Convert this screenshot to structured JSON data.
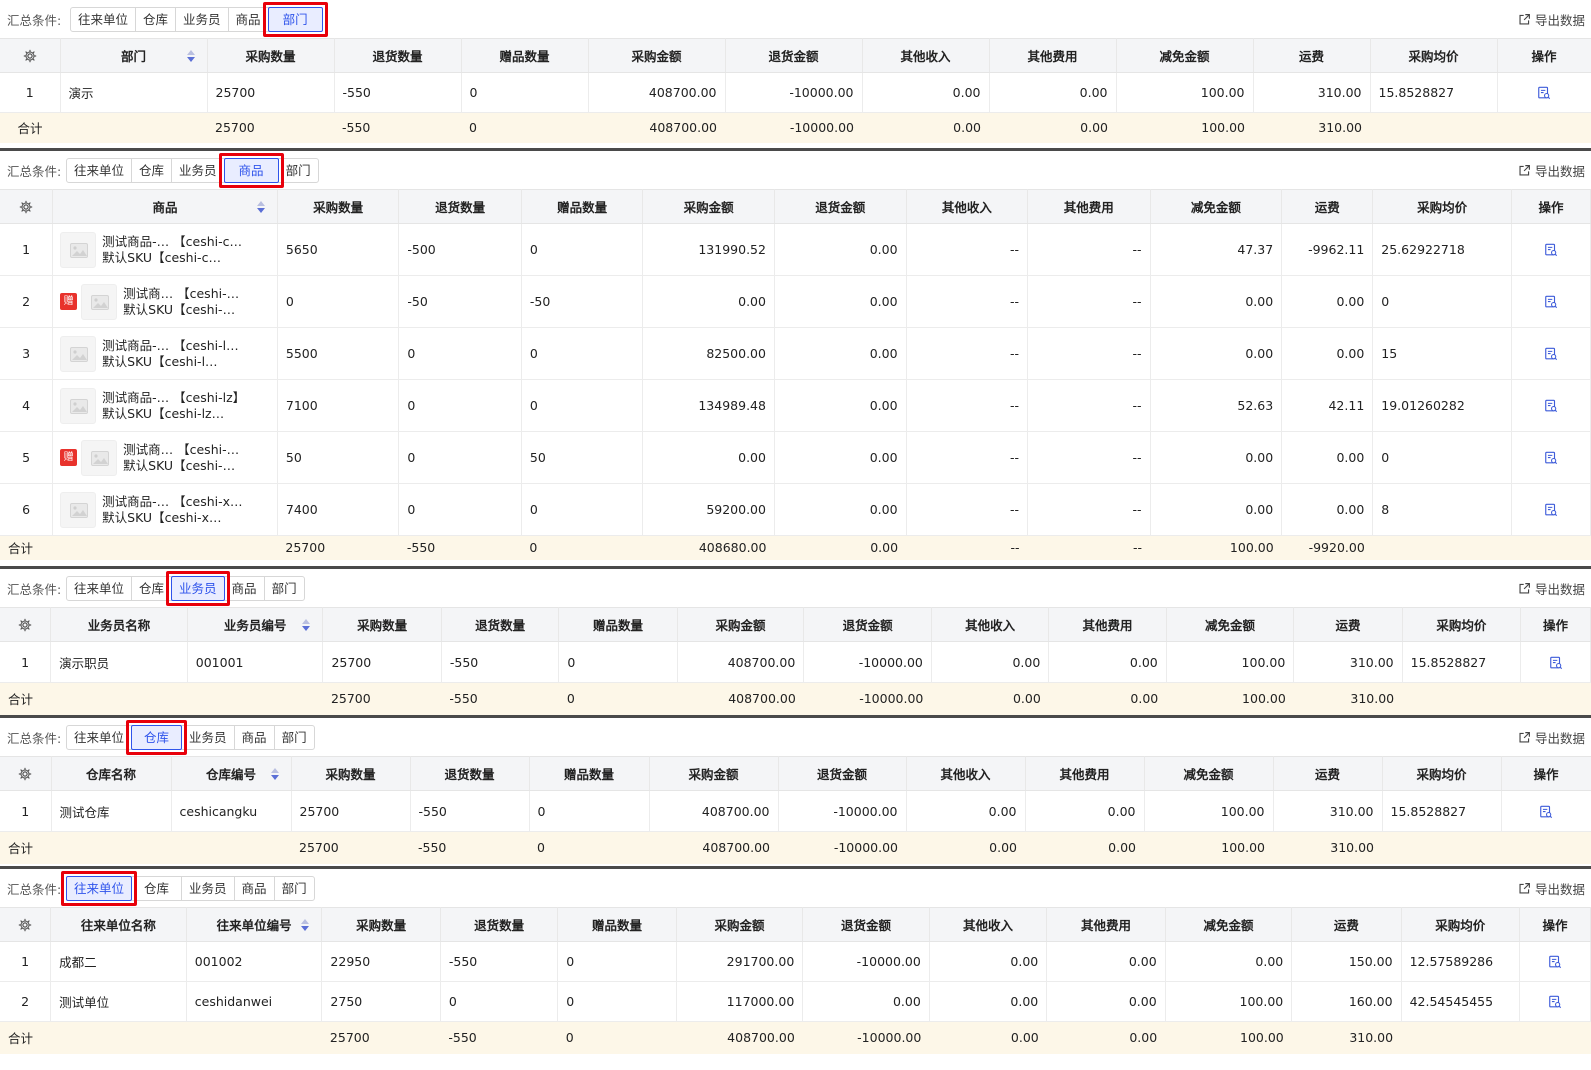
{
  "filter_label": "汇总条件:",
  "tabs": [
    "往来单位",
    "仓库",
    "业务员",
    "商品",
    "部门"
  ],
  "export_label": "导出数据",
  "total_label": "合计",
  "panels": {
    "dept": {
      "active_tab": "部门",
      "headers": [
        "部门",
        "采购数量",
        "退货数量",
        "赠品数量",
        "采购金额",
        "退货金额",
        "其他收入",
        "其他费用",
        "减免金额",
        "运费",
        "采购均价",
        "操作"
      ],
      "rows": [
        {
          "idx": "1",
          "name": "演示",
          "qty": "25700",
          "ret": "-550",
          "gift": "0",
          "amount": "408700.00",
          "ret_amount": "-10000.00",
          "other_in": "0.00",
          "other_fee": "0.00",
          "discount": "100.00",
          "freight": "310.00",
          "avg": "15.8528827"
        }
      ],
      "total": {
        "qty": "25700",
        "ret": "-550",
        "gift": "0",
        "amount": "408700.00",
        "ret_amount": "-10000.00",
        "other_in": "0.00",
        "other_fee": "0.00",
        "discount": "100.00",
        "freight": "310.00"
      }
    },
    "goods": {
      "active_tab": "商品",
      "headers": [
        "商品",
        "采购数量",
        "退货数量",
        "赠品数量",
        "采购金额",
        "退货金额",
        "其他收入",
        "其他费用",
        "减免金额",
        "运费",
        "采购均价",
        "操作"
      ],
      "gift_badge": "赠",
      "rows": [
        {
          "idx": "1",
          "line1": "测试商品-… 【ceshi-c…",
          "line2": "默认SKU【ceshi-c…",
          "gift_flag": false,
          "qty": "5650",
          "ret": "-500",
          "gift": "0",
          "amount": "131990.52",
          "ret_amount": "0.00",
          "other_in": "--",
          "other_fee": "--",
          "discount": "47.37",
          "freight": "-9962.11",
          "avg": "25.62922718"
        },
        {
          "idx": "2",
          "line1": "测试商… 【ceshi-…",
          "line2": "默认SKU【ceshi-…",
          "gift_flag": true,
          "qty": "0",
          "ret": "-50",
          "gift": "-50",
          "amount": "0.00",
          "ret_amount": "0.00",
          "other_in": "--",
          "other_fee": "--",
          "discount": "0.00",
          "freight": "0.00",
          "avg": "0"
        },
        {
          "idx": "3",
          "line1": "测试商品-… 【ceshi-l…",
          "line2": "默认SKU【ceshi-l…",
          "gift_flag": false,
          "qty": "5500",
          "ret": "0",
          "gift": "0",
          "amount": "82500.00",
          "ret_amount": "0.00",
          "other_in": "--",
          "other_fee": "--",
          "discount": "0.00",
          "freight": "0.00",
          "avg": "15"
        },
        {
          "idx": "4",
          "line1": "测试商品-… 【ceshi-lz】",
          "line2": "默认SKU【ceshi-lz…",
          "gift_flag": false,
          "qty": "7100",
          "ret": "0",
          "gift": "0",
          "amount": "134989.48",
          "ret_amount": "0.00",
          "other_in": "--",
          "other_fee": "--",
          "discount": "52.63",
          "freight": "42.11",
          "avg": "19.01260282"
        },
        {
          "idx": "5",
          "line1": "测试商… 【ceshi-…",
          "line2": "默认SKU【ceshi-…",
          "gift_flag": true,
          "qty": "50",
          "ret": "0",
          "gift": "50",
          "amount": "0.00",
          "ret_amount": "0.00",
          "other_in": "--",
          "other_fee": "--",
          "discount": "0.00",
          "freight": "0.00",
          "avg": "0"
        },
        {
          "idx": "6",
          "line1": "测试商品-… 【ceshi-x…",
          "line2": "默认SKU【ceshi-x…",
          "gift_flag": false,
          "qty": "7400",
          "ret": "0",
          "gift": "0",
          "amount": "59200.00",
          "ret_amount": "0.00",
          "other_in": "--",
          "other_fee": "--",
          "discount": "0.00",
          "freight": "0.00",
          "avg": "8"
        }
      ],
      "total": {
        "qty": "25700",
        "ret": "-550",
        "gift": "0",
        "amount": "408680.00",
        "ret_amount": "0.00",
        "other_in": "--",
        "other_fee": "--",
        "discount": "100.00",
        "freight": "-9920.00"
      }
    },
    "staff": {
      "active_tab": "业务员",
      "headers": [
        "业务员名称",
        "业务员编号",
        "采购数量",
        "退货数量",
        "赠品数量",
        "采购金额",
        "退货金额",
        "其他收入",
        "其他费用",
        "减免金额",
        "运费",
        "采购均价",
        "操作"
      ],
      "rows": [
        {
          "idx": "1",
          "name": "演示职员",
          "code": "001001",
          "qty": "25700",
          "ret": "-550",
          "gift": "0",
          "amount": "408700.00",
          "ret_amount": "-10000.00",
          "other_in": "0.00",
          "other_fee": "0.00",
          "discount": "100.00",
          "freight": "310.00",
          "avg": "15.8528827"
        }
      ],
      "total": {
        "qty": "25700",
        "ret": "-550",
        "gift": "0",
        "amount": "408700.00",
        "ret_amount": "-10000.00",
        "other_in": "0.00",
        "other_fee": "0.00",
        "discount": "100.00",
        "freight": "310.00"
      }
    },
    "warehouse": {
      "active_tab": "仓库",
      "headers": [
        "仓库名称",
        "仓库编号",
        "采购数量",
        "退货数量",
        "赠品数量",
        "采购金额",
        "退货金额",
        "其他收入",
        "其他费用",
        "减免金额",
        "运费",
        "采购均价",
        "操作"
      ],
      "rows": [
        {
          "idx": "1",
          "name": "测试仓库",
          "code": "ceshicangku",
          "qty": "25700",
          "ret": "-550",
          "gift": "0",
          "amount": "408700.00",
          "ret_amount": "-10000.00",
          "other_in": "0.00",
          "other_fee": "0.00",
          "discount": "100.00",
          "freight": "310.00",
          "avg": "15.8528827"
        }
      ],
      "total": {
        "qty": "25700",
        "ret": "-550",
        "gift": "0",
        "amount": "408700.00",
        "ret_amount": "-10000.00",
        "other_in": "0.00",
        "other_fee": "0.00",
        "discount": "100.00",
        "freight": "310.00"
      }
    },
    "partner": {
      "active_tab": "往来单位",
      "headers": [
        "往来单位名称",
        "往来单位编号",
        "采购数量",
        "退货数量",
        "赠品数量",
        "采购金额",
        "退货金额",
        "其他收入",
        "其他费用",
        "减免金额",
        "运费",
        "采购均价",
        "操作"
      ],
      "rows": [
        {
          "idx": "1",
          "name": "成都二",
          "code": "001002",
          "qty": "22950",
          "ret": "-550",
          "gift": "0",
          "amount": "291700.00",
          "ret_amount": "-10000.00",
          "other_in": "0.00",
          "other_fee": "0.00",
          "discount": "0.00",
          "freight": "150.00",
          "avg": "12.57589286"
        },
        {
          "idx": "2",
          "name": "测试单位",
          "code": "ceshidanwei",
          "qty": "2750",
          "ret": "0",
          "gift": "0",
          "amount": "117000.00",
          "ret_amount": "0.00",
          "other_in": "0.00",
          "other_fee": "0.00",
          "discount": "100.00",
          "freight": "160.00",
          "avg": "42.54545455"
        }
      ],
      "total": {
        "qty": "25700",
        "ret": "-550",
        "gift": "0",
        "amount": "408700.00",
        "ret_amount": "-10000.00",
        "other_in": "0.00",
        "other_fee": "0.00",
        "discount": "100.00",
        "freight": "310.00"
      }
    }
  }
}
